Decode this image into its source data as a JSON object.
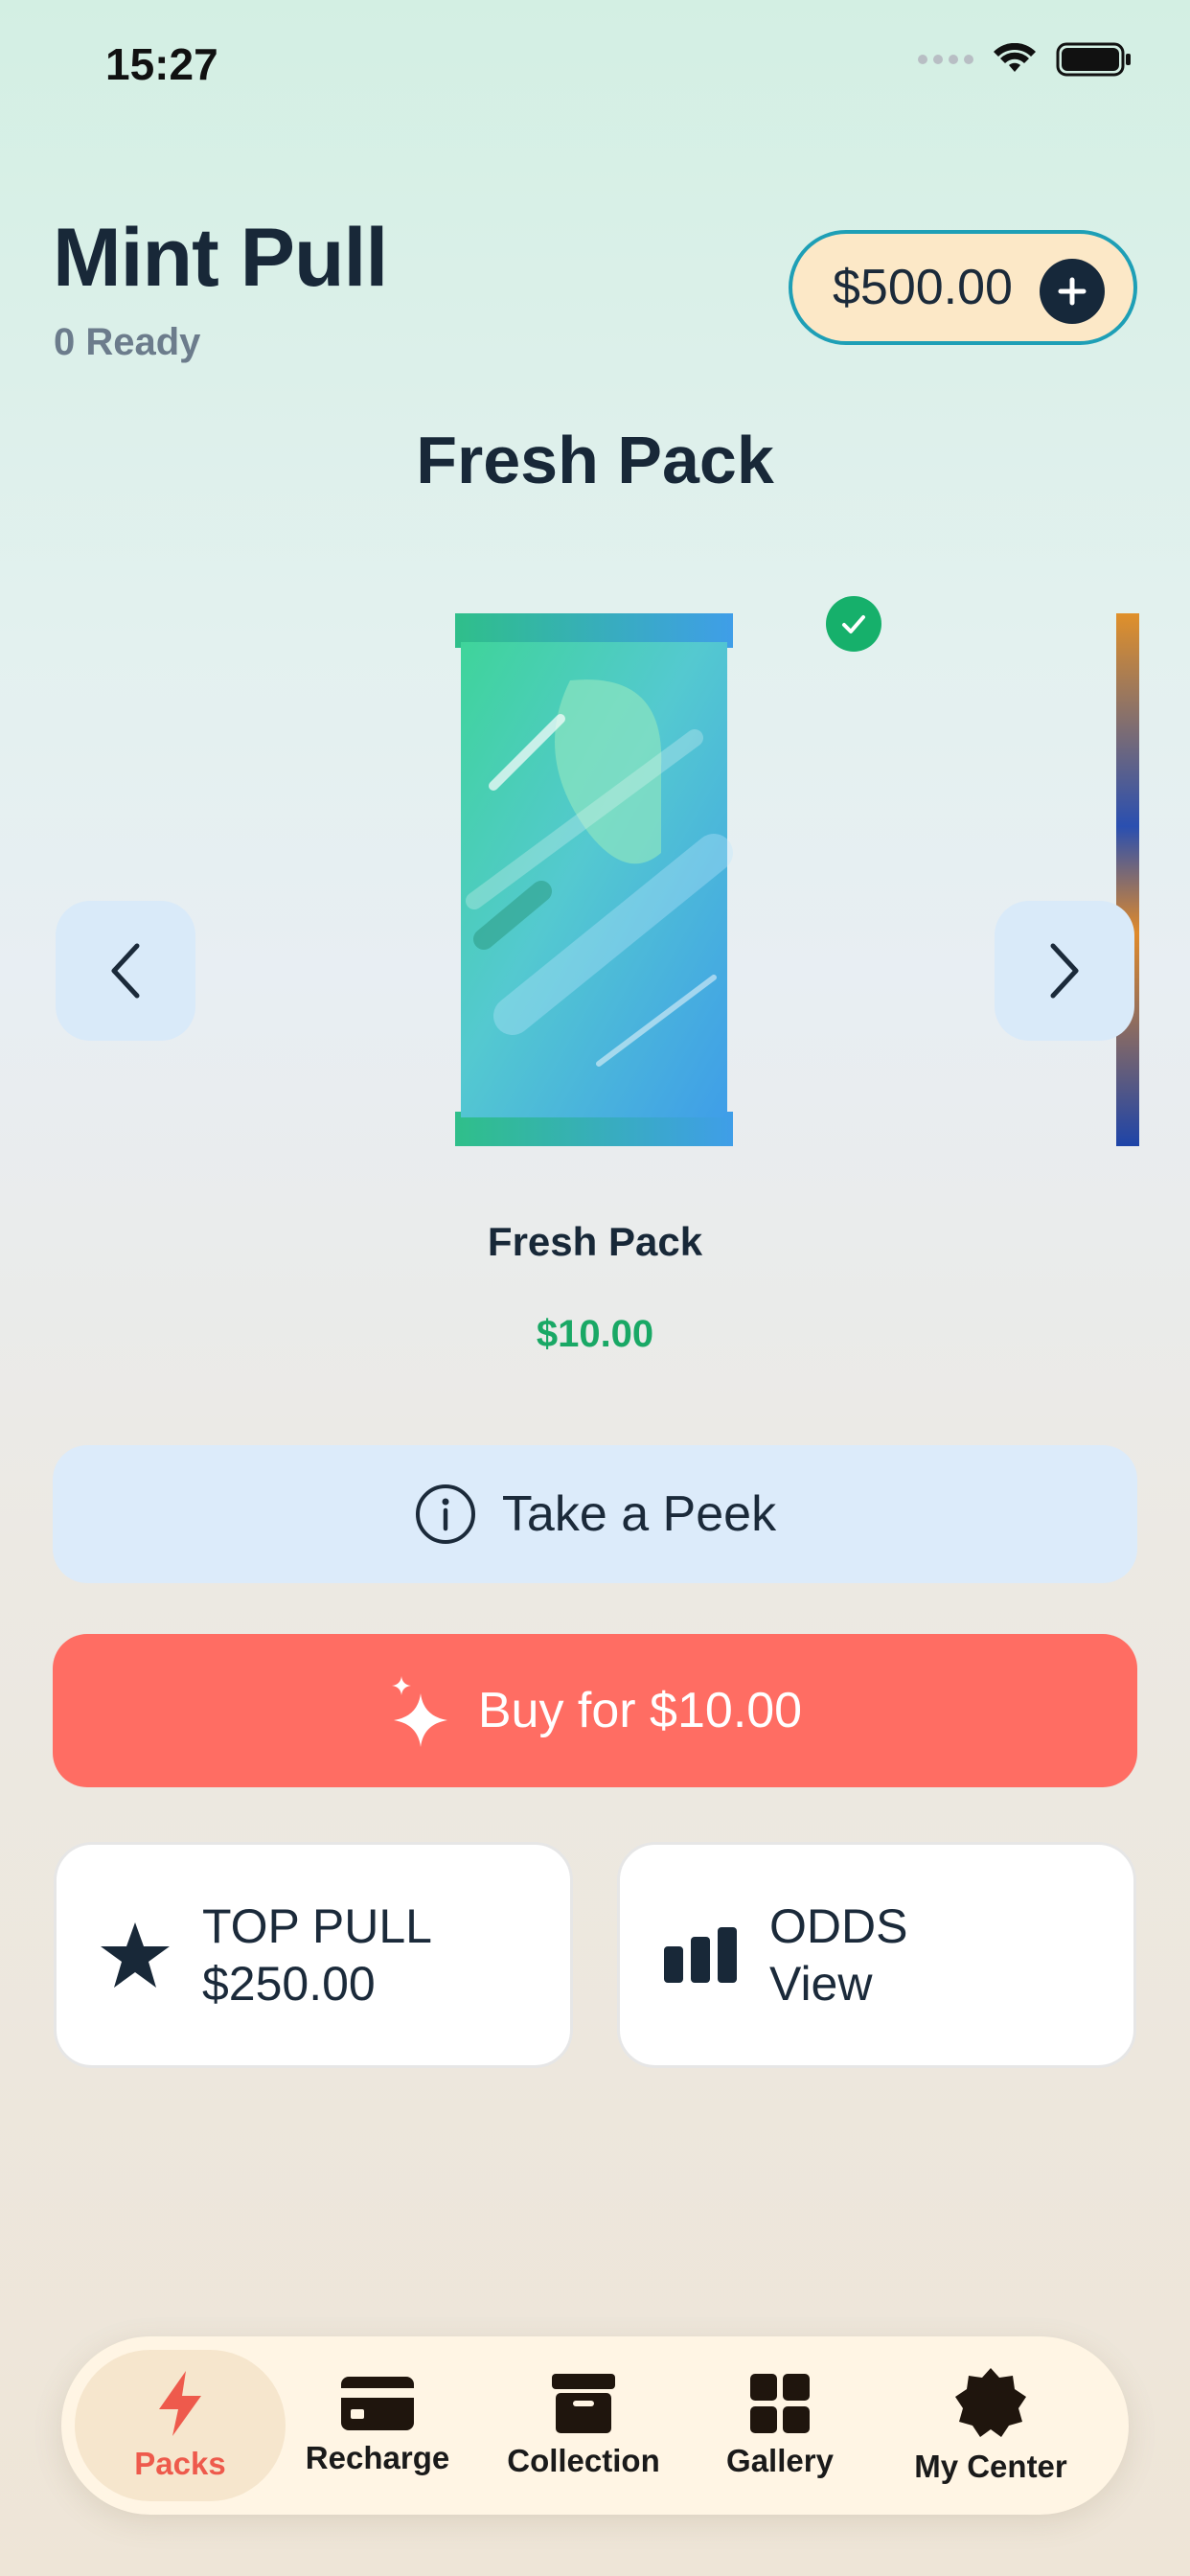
{
  "status": {
    "time": "15:27"
  },
  "header": {
    "title": "Mint Pull",
    "ready": "0 Ready",
    "balance": "$500.00"
  },
  "section_title": "Fresh Pack",
  "pack": {
    "name": "Fresh Pack",
    "price": "$10.00"
  },
  "actions": {
    "peek_label": "Take a Peek",
    "buy_label": "Buy for $10.00"
  },
  "cards": {
    "top_pull": {
      "title": "TOP PULL",
      "value": "$250.00"
    },
    "odds": {
      "title": "ODDS",
      "value": "View"
    }
  },
  "tabs": [
    {
      "label": "Packs",
      "icon": "bolt-icon",
      "active": true
    },
    {
      "label": "Recharge",
      "icon": "card-icon"
    },
    {
      "label": "Collection",
      "icon": "box-icon"
    },
    {
      "label": "Gallery",
      "icon": "grid-icon"
    },
    {
      "label": "My Center",
      "icon": "badge-icon"
    }
  ],
  "colors": {
    "accent": "#ff6d63",
    "price_green": "#19a865",
    "balance_border": "#1e9fb6",
    "active_tab": "#ee5a4c"
  }
}
